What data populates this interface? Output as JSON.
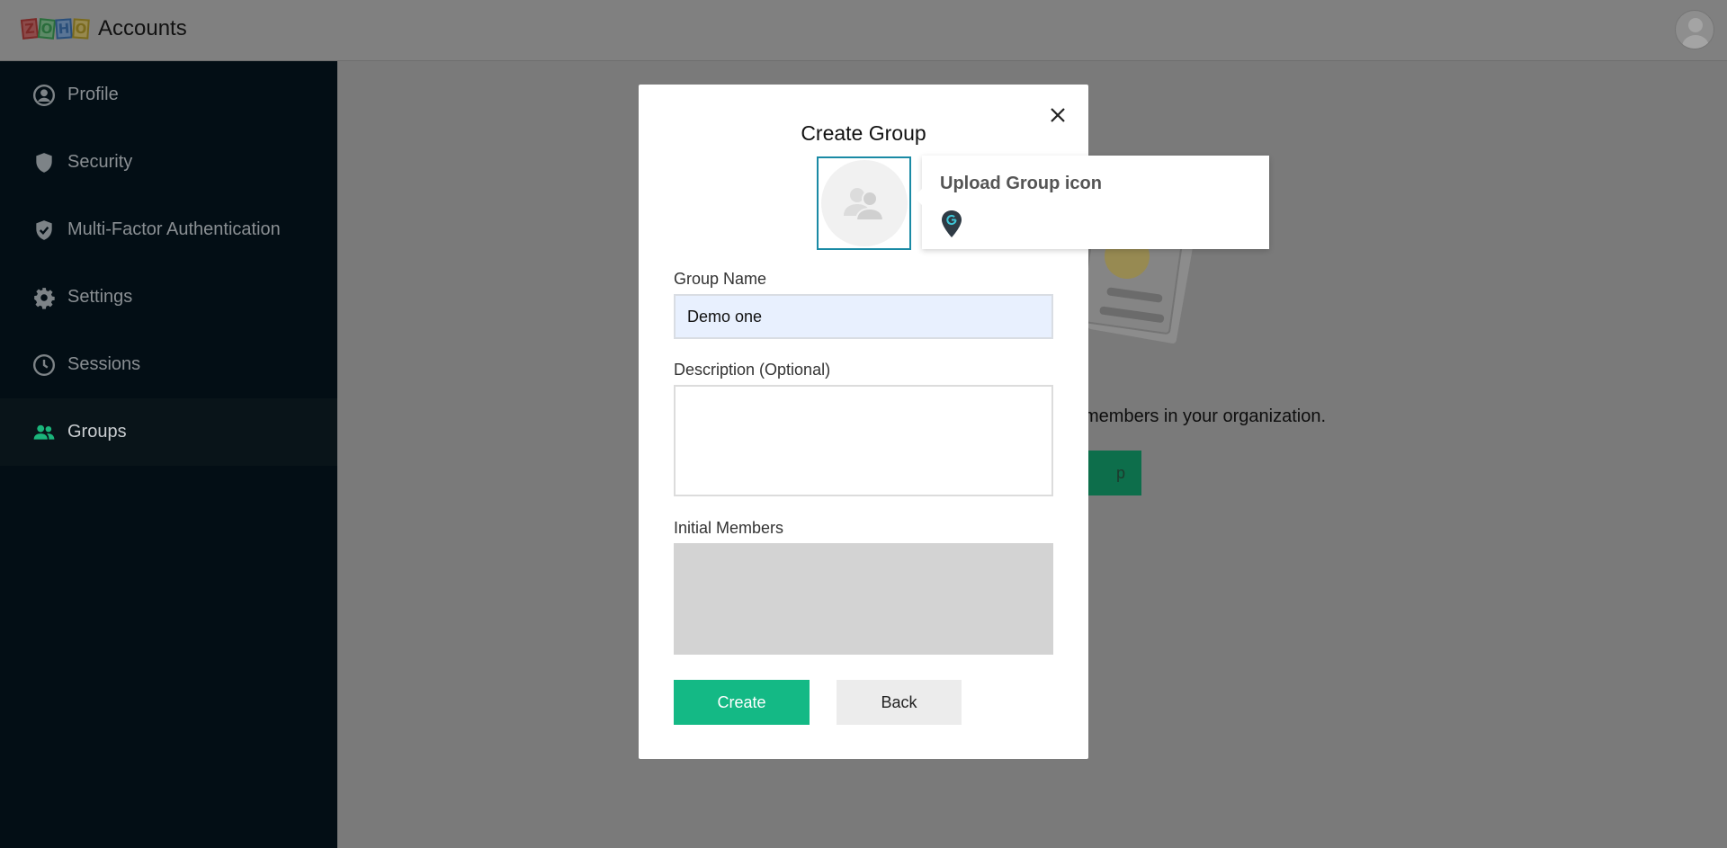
{
  "header": {
    "app_name": "Accounts",
    "logo_letters": [
      "Z",
      "O",
      "H",
      "O"
    ]
  },
  "sidebar": {
    "items": [
      {
        "label": "Profile",
        "icon": "profile-icon",
        "active": false
      },
      {
        "label": "Security",
        "icon": "shield-icon",
        "active": false
      },
      {
        "label": "Multi-Factor Authentication",
        "icon": "shield-check-icon",
        "active": false
      },
      {
        "label": "Settings",
        "icon": "gear-icon",
        "active": false
      },
      {
        "label": "Sessions",
        "icon": "clock-icon",
        "active": false
      },
      {
        "label": "Groups",
        "icon": "group-icon",
        "active": true
      }
    ]
  },
  "background": {
    "text": "members in your organization.",
    "button_label": "p"
  },
  "modal": {
    "title": "Create Group",
    "group_name_label": "Group Name",
    "group_name_value": "Demo one",
    "description_label": "Description (Optional)",
    "description_value": "",
    "members_label": "Initial Members",
    "create_label": "Create",
    "back_label": "Back"
  },
  "popup": {
    "title": "Upload Group icon",
    "icon": "google-drive-pin-icon"
  },
  "colors": {
    "accent": "#14b985",
    "sidebar_bg": "#030e15",
    "active_icon": "#1bb57b",
    "focus_border": "#1a8aa5"
  }
}
